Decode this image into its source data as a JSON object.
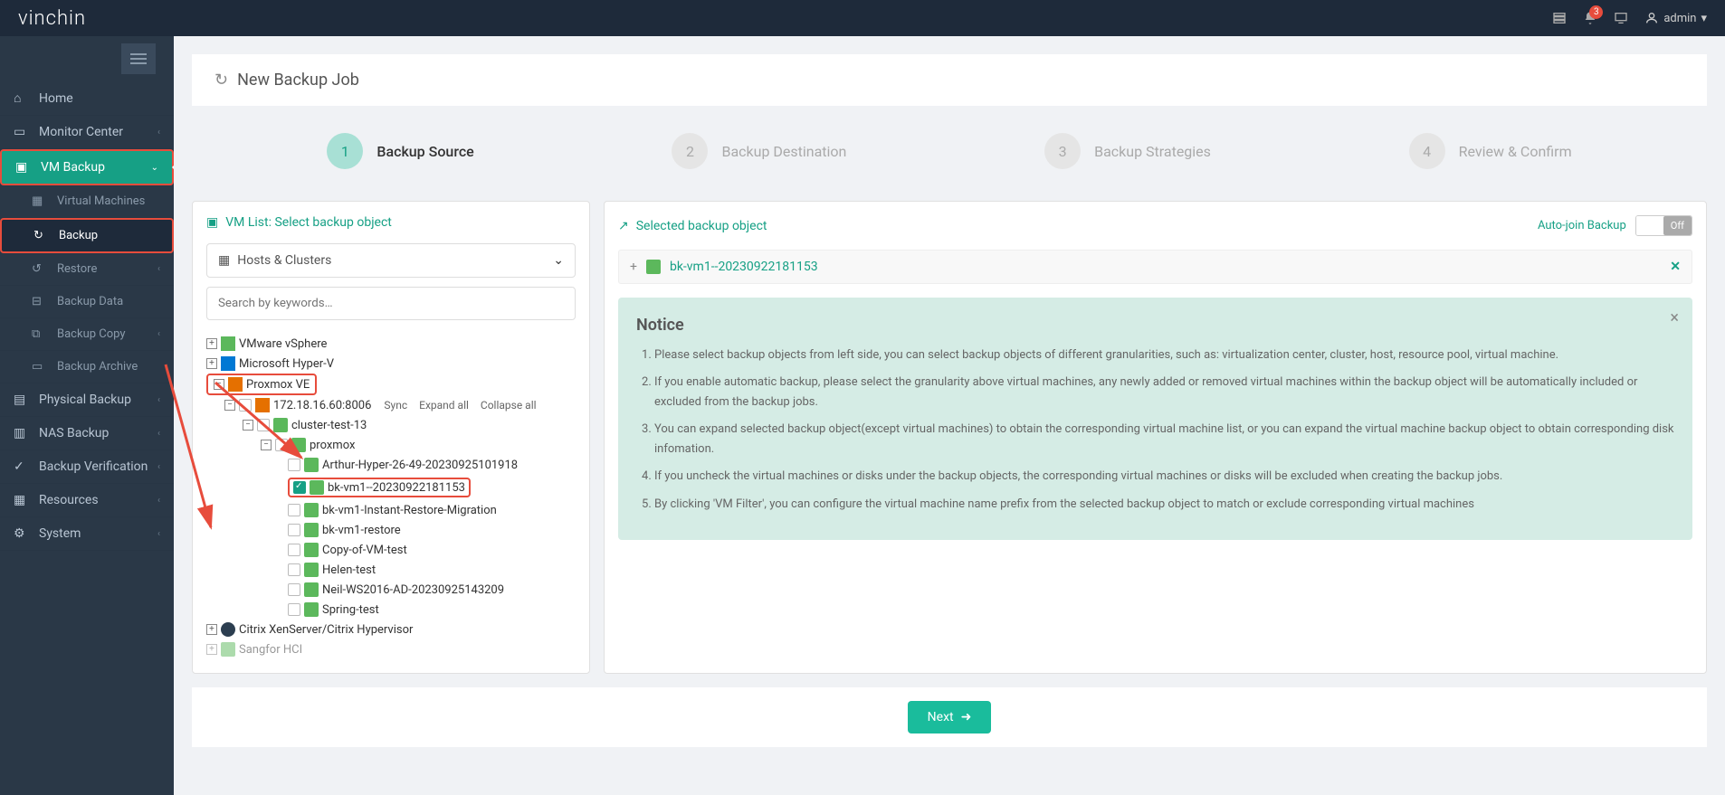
{
  "header": {
    "logo": "vinchin",
    "notification_count": "3",
    "user": "admin"
  },
  "sidebar": {
    "items": [
      {
        "label": "Home",
        "icon": "home-icon"
      },
      {
        "label": "Monitor Center",
        "icon": "monitor-icon",
        "chev": true
      },
      {
        "label": "VM Backup",
        "icon": "vm-icon",
        "active": true,
        "chev": true
      },
      {
        "label": "Virtual Machines",
        "icon": "vms-icon",
        "sub": true
      },
      {
        "label": "Backup",
        "icon": "backup-icon",
        "sub": true,
        "subactive": true
      },
      {
        "label": "Restore",
        "icon": "restore-icon",
        "sub": true,
        "chev": true
      },
      {
        "label": "Backup Data",
        "icon": "data-icon",
        "sub": true
      },
      {
        "label": "Backup Copy",
        "icon": "copy-icon",
        "sub": true,
        "chev": true
      },
      {
        "label": "Backup Archive",
        "icon": "archive-icon",
        "sub": true
      },
      {
        "label": "Physical Backup",
        "icon": "physical-icon",
        "chev": true
      },
      {
        "label": "NAS Backup",
        "icon": "nas-icon",
        "chev": true
      },
      {
        "label": "Backup Verification",
        "icon": "verify-icon",
        "chev": true
      },
      {
        "label": "Resources",
        "icon": "resources-icon",
        "chev": true
      },
      {
        "label": "System",
        "icon": "system-icon",
        "chev": true
      }
    ]
  },
  "page": {
    "title": "New Backup Job",
    "steps": [
      {
        "num": "1",
        "label": "Backup Source"
      },
      {
        "num": "2",
        "label": "Backup Destination"
      },
      {
        "num": "3",
        "label": "Backup Strategies"
      },
      {
        "num": "4",
        "label": "Review & Confirm"
      }
    ]
  },
  "left_panel": {
    "title": "VM List: Select backup object",
    "dropdown": "Hosts & Clusters",
    "search_placeholder": "Search by keywords…",
    "tree_actions": {
      "sync": "Sync",
      "expand": "Expand all",
      "collapse": "Collapse all"
    },
    "tree": {
      "vmware": "VMware vSphere",
      "hyperv": "Microsoft Hyper-V",
      "proxmox": "Proxmox VE",
      "proxmox_host": "172.18.16.60:8006",
      "cluster": "cluster-test-13",
      "node": "proxmox",
      "vms": [
        "Arthur-Hyper-26-49-20230925101918",
        "bk-vm1--20230922181153",
        "bk-vm1-Instant-Restore-Migration",
        "bk-vm1-restore",
        "Copy-of-VM-test",
        "Helen-test",
        "Neil-WS2016-AD-20230925143209",
        "Spring-test"
      ],
      "xen": "Citrix XenServer/Citrix Hypervisor",
      "sangfor": "Sangfor HCI"
    }
  },
  "right_panel": {
    "title": "Selected backup object",
    "auto_join_label": "Auto-join Backup",
    "auto_join_state": "Off",
    "selected_vm": "bk-vm1--20230922181153",
    "notice": {
      "title": "Notice",
      "items": [
        "Please select backup objects from left side, you can select backup objects of different granularities, such as: virtualization center, cluster, host, resource pool, virtual machine.",
        "If you enable automatic backup, please select the granularity above virtual machines, any newly added or removed virtual machines within the backup object will be automatically included or excluded from the backup jobs.",
        "You can expand selected backup object(except virtual machines) to obtain the corresponding virtual machine list, or you can expand the virtual machine backup object to obtain corresponding disk infomation.",
        "If you uncheck the virtual machines or disks under the backup objects, the corresponding virtual machines or disks will be excluded when creating the backup jobs.",
        "By clicking 'VM Filter', you can configure the virtual machine name prefix from the selected backup object to match or exclude corresponding virtual machines"
      ]
    }
  },
  "footer": {
    "next": "Next"
  }
}
